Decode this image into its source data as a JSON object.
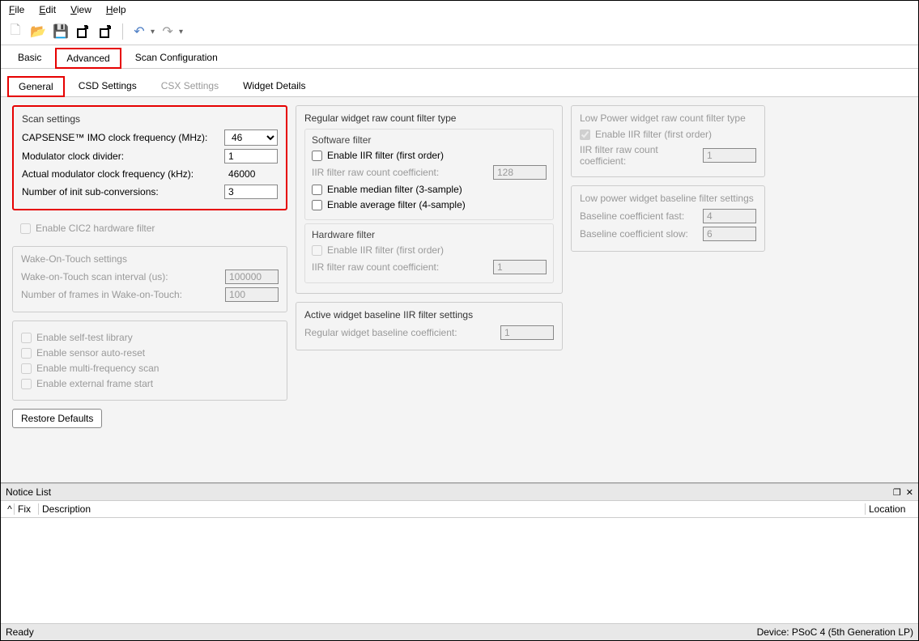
{
  "menu": {
    "file": "File",
    "edit": "Edit",
    "view": "View",
    "help": "Help"
  },
  "tabs1": {
    "basic": "Basic",
    "advanced": "Advanced",
    "scanconfig": "Scan Configuration"
  },
  "tabs2": {
    "general": "General",
    "csd": "CSD Settings",
    "csx": "CSX Settings",
    "widget": "Widget Details"
  },
  "scan": {
    "title": "Scan settings",
    "imo_label": "CAPSENSE™ IMO clock frequency (MHz):",
    "imo_value": "46",
    "mod_label": "Modulator clock divider:",
    "mod_value": "1",
    "actual_label": "Actual modulator clock frequency (kHz):",
    "actual_value": "46000",
    "init_label": "Number of init sub-conversions:",
    "init_value": "3",
    "cic2": "Enable CIC2 hardware filter"
  },
  "wot": {
    "title": "Wake-On-Touch settings",
    "interval_label": "Wake-on-Touch scan interval (us):",
    "interval_value": "100000",
    "frames_label": "Number of frames in Wake-on-Touch:",
    "frames_value": "100"
  },
  "misc": {
    "selftest": "Enable self-test library",
    "autoreset": "Enable sensor auto-reset",
    "multifreq": "Enable multi-frequency scan",
    "extframe": "Enable external frame start"
  },
  "restore": "Restore Defaults",
  "regfilter": {
    "title": "Regular widget raw count filter type",
    "sw_title": "Software filter",
    "iir": "Enable IIR filter (first order)",
    "iir_coef_label": "IIR filter raw count coefficient:",
    "iir_coef_value": "128",
    "median": "Enable median filter (3-sample)",
    "average": "Enable average filter (4-sample)",
    "hw_title": "Hardware filter",
    "hw_iir": "Enable IIR filter (first order)",
    "hw_iir_coef_label": "IIR filter raw count coefficient:",
    "hw_iir_coef_value": "1"
  },
  "activebaseline": {
    "title": "Active widget baseline IIR filter settings",
    "coef_label": "Regular widget baseline coefficient:",
    "coef_value": "1"
  },
  "lpfilter": {
    "title": "Low Power widget raw count filter type",
    "iir": "Enable IIR filter (first order)",
    "coef_label": "IIR filter raw count coefficient:",
    "coef_value": "1"
  },
  "lpbaseline": {
    "title": "Low power widget baseline filter settings",
    "fast_label": "Baseline coefficient fast:",
    "fast_value": "4",
    "slow_label": "Baseline coefficient slow:",
    "slow_value": "6"
  },
  "notice": {
    "title": "Notice List",
    "fix": "Fix",
    "desc": "Description",
    "loc": "Location"
  },
  "status": {
    "ready": "Ready",
    "device": "Device: PSoC 4 (5th Generation LP)"
  }
}
